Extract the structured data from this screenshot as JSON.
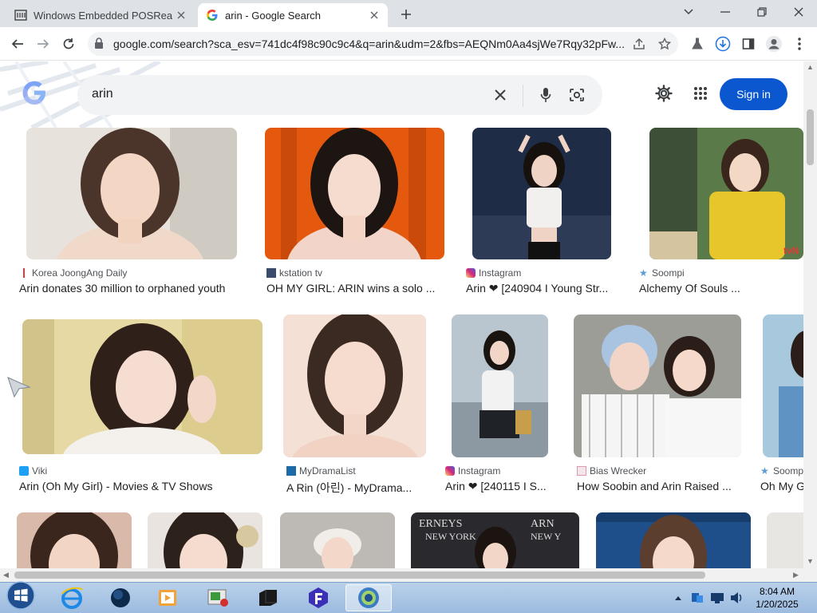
{
  "browser": {
    "tabs": [
      {
        "title": "Windows Embedded POSReady"
      },
      {
        "title": "arin - Google Search"
      }
    ],
    "url": "google.com/search?sca_esv=741dc4f98c90c9c4&q=arin&udm=2&fbs=AEQNm0Aa4sjWe7Rqy32pFw..."
  },
  "search": {
    "query": "arin",
    "signin_label": "Sign in"
  },
  "results": [
    {
      "source": "Korea JoongAng Daily",
      "title": "Arin donates 30 million to orphaned youth"
    },
    {
      "source": "kstation tv",
      "title": "OH MY GIRL: ARIN wins a solo ..."
    },
    {
      "source": "Instagram",
      "title": "Arin ❤ [240904 I Young Str..."
    },
    {
      "source": "Soompi",
      "title": "Alchemy Of Souls ..."
    },
    {
      "source": "Viki",
      "title": "Arin (Oh My Girl) - Movies & TV Shows"
    },
    {
      "source": "MyDramaList",
      "title": "A Rin (아린) - MyDrama..."
    },
    {
      "source": "Instagram",
      "title": "Arin ❤ [240115 I S..."
    },
    {
      "source": "Bias Wrecker",
      "title": "How Soobin and Arin Raised ..."
    },
    {
      "source": "Soompi",
      "title": "Oh My G"
    }
  ],
  "taskbar": {
    "time": "8:04 AM",
    "date": "1/20/2025"
  },
  "colors": {
    "accent": "#0b57d0",
    "tab_bg": "#dee1e6",
    "omnibox_bg": "#f1f3f4"
  }
}
